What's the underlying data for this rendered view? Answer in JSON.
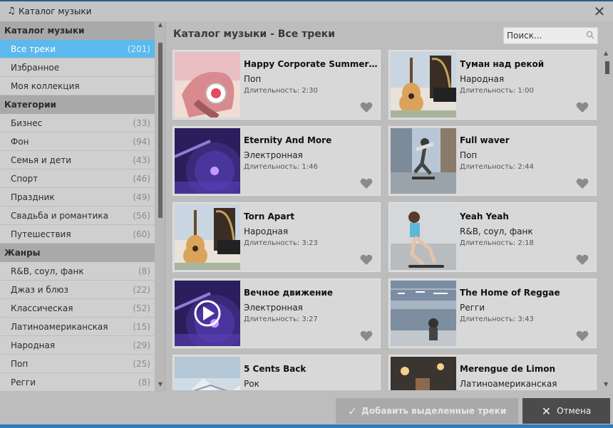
{
  "window": {
    "title": "Каталог музыки"
  },
  "sidebar": {
    "sections": [
      {
        "title": "Каталог музыки",
        "items": [
          {
            "label": "Все треки",
            "count": "(201)",
            "active": true
          },
          {
            "label": "Избранное",
            "count": ""
          },
          {
            "label": "Моя коллекция",
            "count": ""
          }
        ]
      },
      {
        "title": "Категории",
        "items": [
          {
            "label": "Бизнес",
            "count": "(33)"
          },
          {
            "label": "Фон",
            "count": "(94)"
          },
          {
            "label": "Семья и дети",
            "count": "(43)"
          },
          {
            "label": "Спорт",
            "count": "(46)"
          },
          {
            "label": "Праздник",
            "count": "(49)"
          },
          {
            "label": "Свадьба и романтика",
            "count": "(56)"
          },
          {
            "label": "Путешествия",
            "count": "(60)"
          }
        ]
      },
      {
        "title": "Жанры",
        "items": [
          {
            "label": "R&B, соул, фанк",
            "count": "(8)"
          },
          {
            "label": "Джаз и блюз",
            "count": "(22)"
          },
          {
            "label": "Классическая",
            "count": "(52)"
          },
          {
            "label": "Латиноамериканская",
            "count": "(15)"
          },
          {
            "label": "Народная",
            "count": "(29)"
          },
          {
            "label": "Поп",
            "count": "(25)"
          },
          {
            "label": "Регги",
            "count": "(8)"
          }
        ]
      }
    ]
  },
  "main": {
    "title": "Каталог музыки - Все треки",
    "search_placeholder": "Поиск...",
    "tracks": [
      {
        "title": "Happy Corporate Summer Jo...",
        "genre": "Поп",
        "duration": "Длительность: 2:30",
        "thumb": "headphones"
      },
      {
        "title": "Туман над рекой",
        "genre": "Народная",
        "duration": "Длительность: 1:00",
        "thumb": "guitar"
      },
      {
        "title": "Eternity And More",
        "genre": "Электронная",
        "duration": "Длительность: 1:46",
        "thumb": "turntable"
      },
      {
        "title": "Full waver",
        "genre": "Поп",
        "duration": "Длительность: 2:44",
        "thumb": "skater"
      },
      {
        "title": "Torn Apart",
        "genre": "Народная",
        "duration": "Длительность: 3:23",
        "thumb": "guitar"
      },
      {
        "title": "Yeah Yeah",
        "genre": "R&B, соул, фанк",
        "duration": "Длительность: 2:18",
        "thumb": "girl"
      },
      {
        "title": "Вечное движение",
        "genre": "Электронная",
        "duration": "Длительность: 3:27",
        "thumb": "turntable-play"
      },
      {
        "title": "The Home of Reggae",
        "genre": "Регги",
        "duration": "Длительность: 3:43",
        "thumb": "street"
      },
      {
        "title": "5 Cents Back",
        "genre": "Рок",
        "duration": "",
        "thumb": "winter"
      },
      {
        "title": "Merengue de Limon",
        "genre": "Латиноамериканская",
        "duration": "",
        "thumb": "bar"
      }
    ]
  },
  "footer": {
    "add_label": "Добавить выделенные треки",
    "cancel_label": "Отмена"
  },
  "colors": {
    "accent": "#5bb9ee",
    "cancel_bg": "#4b4b4b",
    "window_border": "#2e7cc0"
  }
}
